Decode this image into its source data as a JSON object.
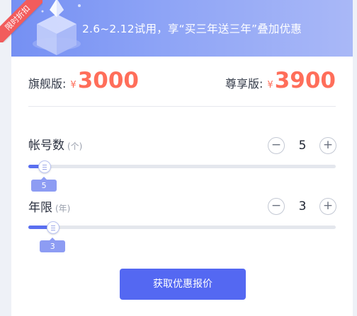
{
  "banner": {
    "ribbon": "限时折扣",
    "text": "2.6~2.12试用，享“买三年送三年”叠加优惠"
  },
  "prices": {
    "flagship": {
      "label": "旗舰版:",
      "currency": "¥",
      "amount": "3000"
    },
    "premium": {
      "label": "尊享版:",
      "currency": "¥",
      "amount": "3900"
    }
  },
  "accounts": {
    "label": "帐号数",
    "unit": "(个)",
    "value": "5",
    "tip": "5",
    "minus": "−",
    "plus": "+",
    "slider_fraction": 0.02
  },
  "years": {
    "label": "年限",
    "unit": "(年)",
    "value": "3",
    "tip": "3",
    "minus": "−",
    "plus": "+",
    "slider_fraction": 0.05
  },
  "cta": {
    "label": "获取优惠报价"
  },
  "colors": {
    "accent": "#5468f2",
    "price": "#ff6e5a",
    "ribbon": "#f25c5c"
  },
  "icons": [
    "cube-illustration-icon",
    "minus-icon",
    "plus-icon",
    "slider-knob-icon"
  ]
}
